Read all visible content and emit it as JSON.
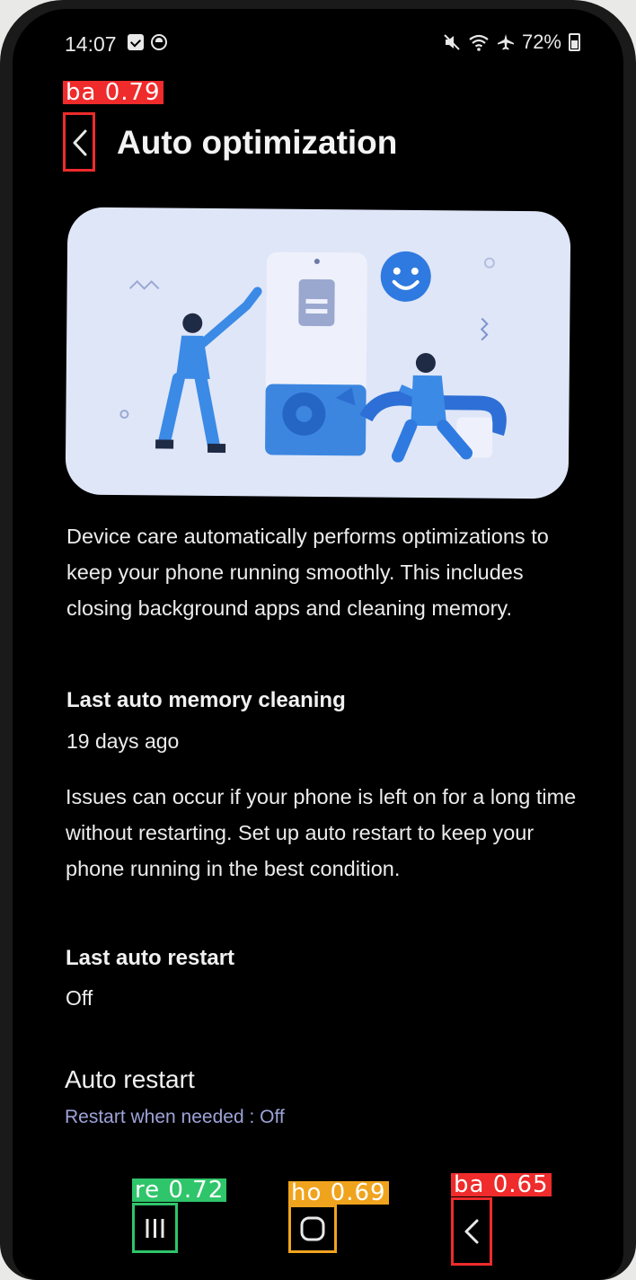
{
  "status_bar": {
    "time": "14:07",
    "battery": "72%"
  },
  "header": {
    "title": "Auto optimization"
  },
  "intro_text": "Device care automatically performs optimizations to keep your phone running smoothly. This includes closing background apps and cleaning memory.",
  "memory_section": {
    "heading": "Last auto memory cleaning",
    "value": "19 days ago"
  },
  "restart_info_text": "Issues can occur if your phone is left on for a long time without restarting. Set up auto restart to keep your phone running in the best condition.",
  "restart_section": {
    "heading": "Last auto restart",
    "value": "Off"
  },
  "auto_restart": {
    "title": "Auto restart",
    "subtitle": "Restart when needed : Off"
  },
  "detections": {
    "header_back": "ba  0.79",
    "recents": "re  0.72",
    "home": "ho  0.69",
    "nav_back": "ba  0.65"
  },
  "colors": {
    "back_box": "#ef2b2b",
    "recents_box": "#2fc56a",
    "home_box": "#f0a41e",
    "accent_subtitle": "#9ea3d8"
  },
  "icons": [
    "message-icon",
    "sync-icon",
    "mute-icon",
    "wifi-icon",
    "airplane-icon",
    "battery-icon",
    "back-arrow-icon",
    "recents-icon",
    "home-icon",
    "nav-back-icon"
  ]
}
